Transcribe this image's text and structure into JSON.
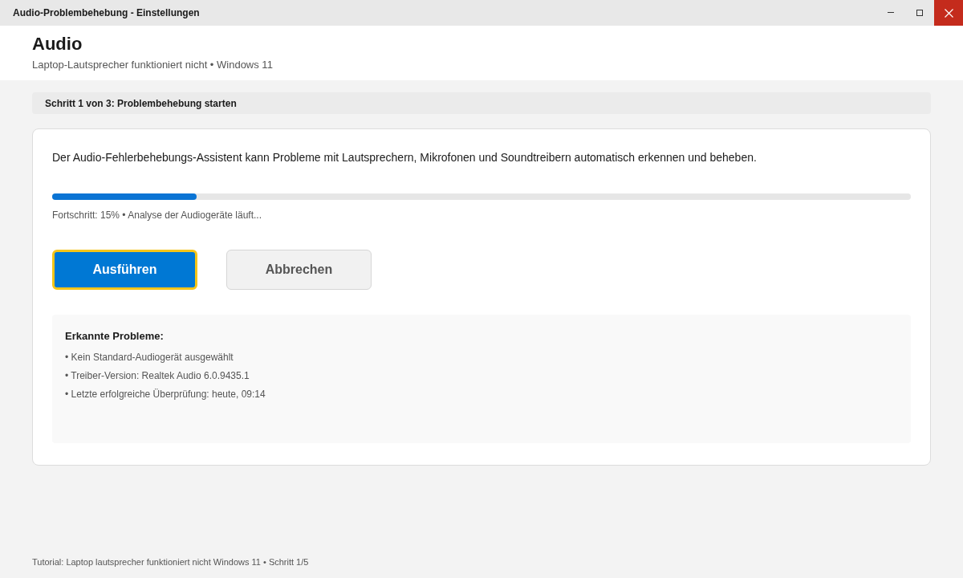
{
  "window": {
    "title": "Audio-Problembehebung - Einstellungen"
  },
  "header": {
    "title": "Audio",
    "subtitle": "Laptop-Lautsprecher funktioniert nicht • Windows 11"
  },
  "step": {
    "label": "Schritt 1 von 3: Problembehebung starten"
  },
  "card": {
    "description": "Der Audio-Fehlerbehebungs-Assistent kann Probleme mit Lautsprechern, Mikrofonen und Soundtreibern automatisch erkennen und beheben.",
    "progress": {
      "level": 0.168,
      "reading": "Fortschritt: 15% • Analyse der Audiogeräte läuft..."
    },
    "buttons": [
      {
        "label": "Ausführen",
        "kind": "primary",
        "focused": true
      },
      {
        "label": "Abbrechen",
        "kind": "secondary",
        "focused": false
      }
    ],
    "issues": {
      "title": "Erkannte Probleme:",
      "items": [
        "• Kein Standard-Audiogerät ausgewählt",
        "• Treiber-Version: Realtek Audio 6.0.9435.1",
        "• Letzte erfolgreiche Überprüfung: heute, 09:14"
      ]
    }
  },
  "status_bar": {
    "text": "Tutorial: Laptop lautsprecher funktioniert nicht Windows 11 • Schritt 1/5"
  }
}
